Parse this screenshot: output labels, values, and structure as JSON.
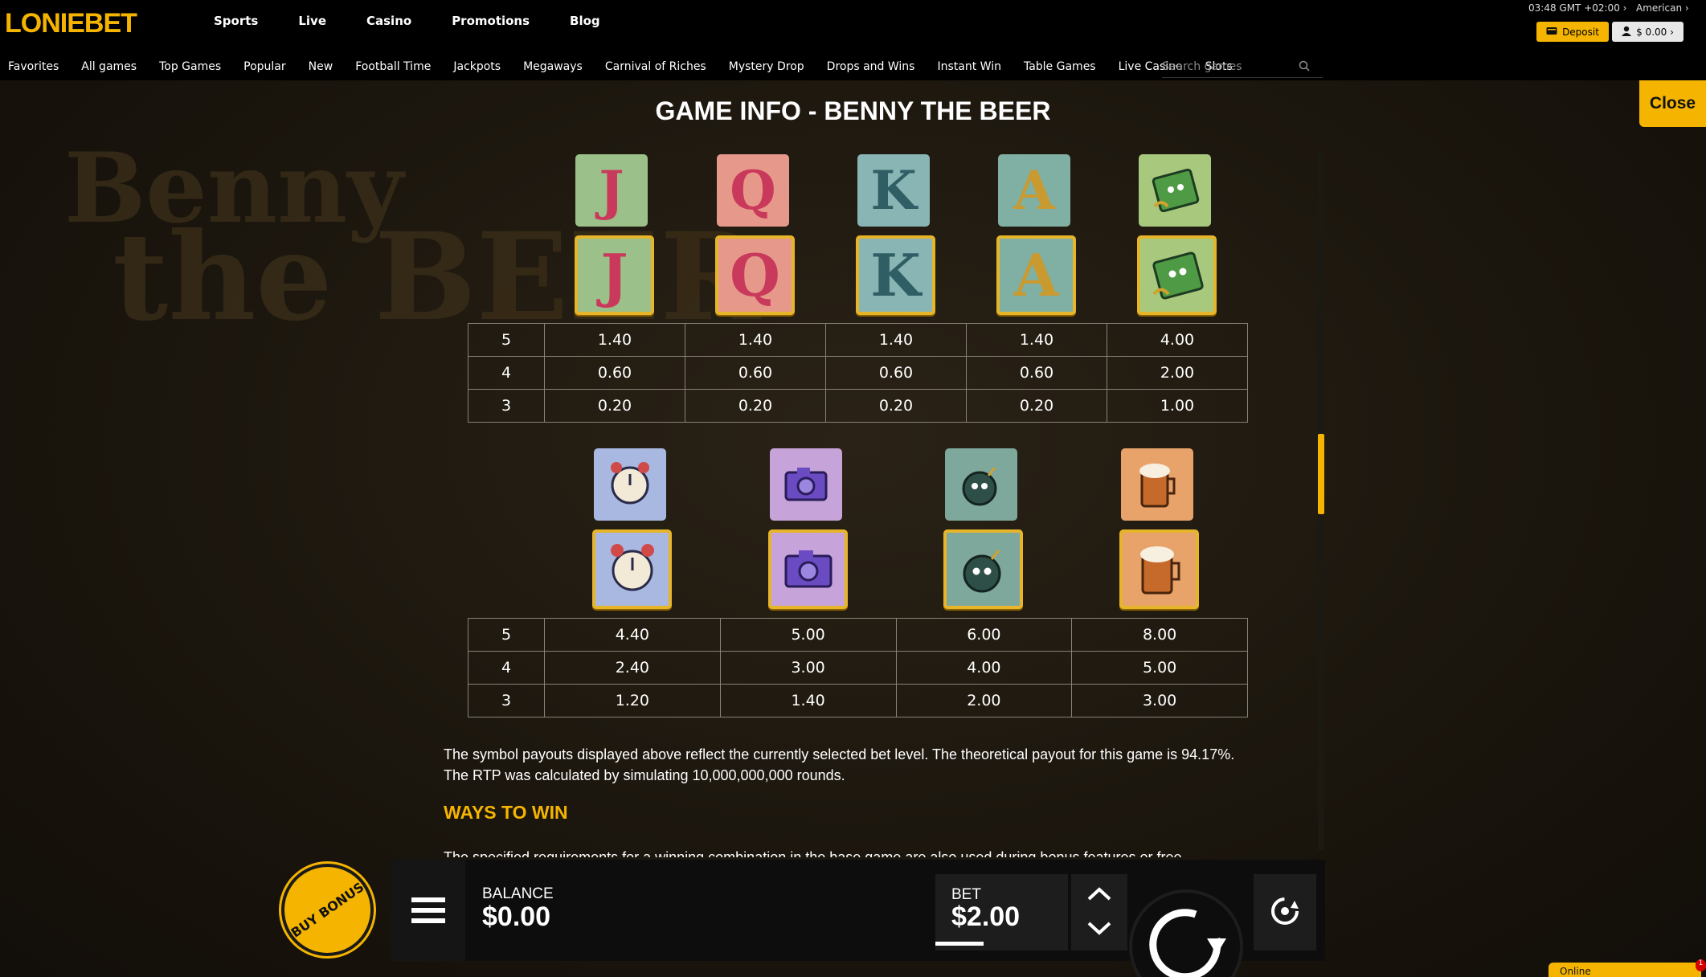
{
  "header": {
    "logo_prefix": "LO",
    "logo_suffix": "NIEBET",
    "main_nav": [
      "Sports",
      "Live",
      "Casino",
      "Promotions",
      "Blog"
    ],
    "clock": "03:48 GMT +02:00 ›",
    "odds_format": "American ›",
    "deposit_label": "Deposit",
    "balance_label": "$ 0.00 ›"
  },
  "categories": [
    "Favorites",
    "All games",
    "Top Games",
    "Popular",
    "New",
    "Football Time",
    "Jackpots",
    "Megaways",
    "Carnival of Riches",
    "Mystery Drop",
    "Drops and Wins",
    "Instant Win",
    "Table Games",
    "Live Casino",
    "Slots"
  ],
  "search": {
    "placeholder": "Search games"
  },
  "game_info": {
    "close_label": "Close",
    "title": "GAME INFO - BENNY THE BEER",
    "bg_title_1": "Benny",
    "bg_title_2": "the BEER",
    "table1": {
      "symbols": [
        "J",
        "Q",
        "K",
        "A",
        "wallet-icon"
      ],
      "rows": [
        {
          "count": "5",
          "values": [
            "1.40",
            "1.40",
            "1.40",
            "1.40",
            "4.00"
          ]
        },
        {
          "count": "4",
          "values": [
            "0.60",
            "0.60",
            "0.60",
            "0.60",
            "2.00"
          ]
        },
        {
          "count": "3",
          "values": [
            "0.20",
            "0.20",
            "0.20",
            "0.20",
            "1.00"
          ]
        }
      ]
    },
    "table2": {
      "symbols": [
        "alarm-clock-icon",
        "camera-icon",
        "bomb-icon",
        "beer-mug-icon"
      ],
      "rows": [
        {
          "count": "5",
          "values": [
            "4.40",
            "5.00",
            "6.00",
            "8.00"
          ]
        },
        {
          "count": "4",
          "values": [
            "2.40",
            "3.00",
            "4.00",
            "5.00"
          ]
        },
        {
          "count": "3",
          "values": [
            "1.20",
            "1.40",
            "2.00",
            "3.00"
          ]
        }
      ]
    },
    "rtp_text": "The symbol payouts displayed above reflect the currently selected bet level. The theoretical payout for this game is 94.17%. The RTP was calculated by simulating 10,000,000,000 rounds.",
    "ways_heading": "WAYS TO WIN",
    "ways_text": "The specified requirements for a winning combination in the base game are also used during bonus features or free"
  },
  "controls": {
    "buy_bonus": "BUY BONUS",
    "balance_label": "BALANCE",
    "balance_value": "$0.00",
    "bet_label": "BET",
    "bet_value": "$2.00"
  },
  "chat": {
    "label": "Online",
    "badge": "1"
  }
}
